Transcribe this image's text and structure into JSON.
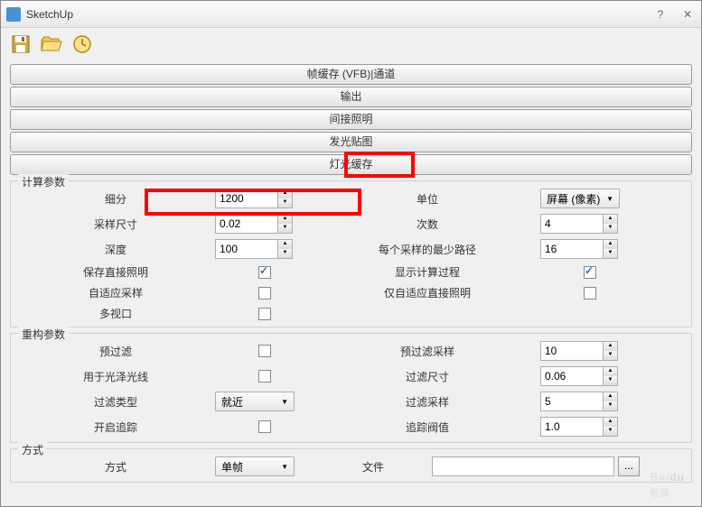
{
  "window": {
    "title": "SketchUp"
  },
  "toolbar": {
    "save_icon": "save-icon",
    "open_icon": "folder-open-icon",
    "options_icon": "clock-icon"
  },
  "accordion": {
    "vfb": "帧缓存 (VFB)|通道",
    "output": "输出",
    "indirect": "间接照明",
    "emissive": "发光贴图",
    "lightcache": "灯光缓存"
  },
  "sections": {
    "calc": {
      "legend": "计算参数",
      "subdivs_label": "细分",
      "subdivs": "1200",
      "unit_label": "单位",
      "unit_value": "屏幕 (像素)",
      "sample_size_label": "采样尺寸",
      "sample_size": "0.02",
      "passes_label": "次数",
      "passes": "4",
      "depth_label": "深度",
      "depth": "100",
      "min_paths_label": "每个采样的最少路径",
      "min_paths": "16",
      "store_direct_label": "保存直接照明",
      "show_calc_label": "显示计算过程",
      "adaptive_label": "自适应采样",
      "only_adapt_label": "仅自适应直接照明",
      "multiview_label": "多视口"
    },
    "recon": {
      "legend": "重构参数",
      "prefilter_label": "预过滤",
      "prefilter_samples_label": "预过滤采样",
      "prefilter_samples": "10",
      "glossy_label": "用于光泽光线",
      "filter_size_label": "过滤尺寸",
      "filter_size": "0.06",
      "filter_type_label": "过滤类型",
      "filter_type_value": "就近",
      "filter_samples_label": "过滤采样",
      "filter_samples": "5",
      "retrace_label": "开启追踪",
      "retrace_thresh_label": "追踪阀值",
      "retrace_thresh": "1.0"
    },
    "mode": {
      "legend": "方式",
      "mode_label": "方式",
      "mode_value": "单帧",
      "file_label": "文件",
      "file_browse": "..."
    }
  },
  "watermark": {
    "main": "Baidu",
    "sub": "经验"
  }
}
